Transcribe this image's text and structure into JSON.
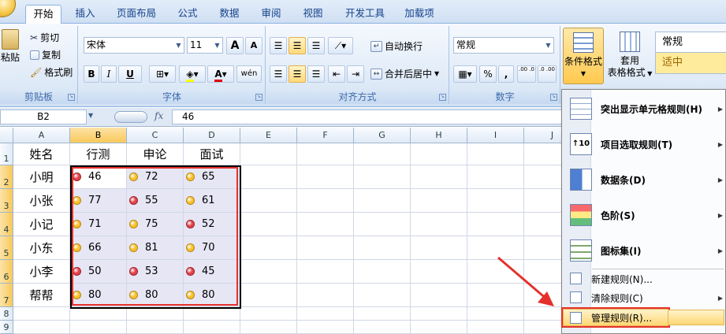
{
  "tabs": [
    "开始",
    "插入",
    "页面布局",
    "公式",
    "数据",
    "审阅",
    "视图",
    "开发工具",
    "加载项"
  ],
  "ribbon": {
    "clipboard": {
      "paste": "粘贴",
      "cut": "剪切",
      "copy": "复制",
      "format_painter": "格式刷",
      "label": "剪贴板"
    },
    "font": {
      "name": "宋体",
      "size": "11",
      "grow": "A",
      "shrink": "A",
      "bold": "B",
      "italic": "I",
      "underline": "U",
      "font_color_letter": "A",
      "phonetic": "wén",
      "label": "字体"
    },
    "alignment": {
      "wrap": "自动换行",
      "merge": "合并后居中",
      "label": "对齐方式"
    },
    "number": {
      "format": "常规",
      "percent": "%",
      "comma": ",",
      "inc_decimal": ".00 .0",
      "dec_decimal": ".0 .00",
      "label": "数字"
    },
    "styles": {
      "conditional": "条件格式",
      "table_line1": "套用",
      "table_line2": "表格格式",
      "normal": "常规",
      "neutral": "适中"
    }
  },
  "formula_bar": {
    "name_box": "B2",
    "fx": "fx",
    "content": "46"
  },
  "columns": [
    "A",
    "B",
    "C",
    "D",
    "E",
    "F",
    "G",
    "H",
    "I",
    "J"
  ],
  "rows": [
    "1",
    "2",
    "3",
    "4",
    "5",
    "6",
    "7",
    "8",
    "9"
  ],
  "headers": [
    "姓名",
    "行测",
    "申论",
    "面试"
  ],
  "records": [
    {
      "name": "小明",
      "v": [
        "46",
        "72",
        "65"
      ],
      "c": [
        "red",
        "yellow",
        "yellow"
      ]
    },
    {
      "name": "小张",
      "v": [
        "77",
        "55",
        "61"
      ],
      "c": [
        "yellow",
        "red",
        "yellow"
      ]
    },
    {
      "name": "小记",
      "v": [
        "71",
        "75",
        "52"
      ],
      "c": [
        "yellow",
        "yellow",
        "red"
      ]
    },
    {
      "name": "小东",
      "v": [
        "66",
        "81",
        "70"
      ],
      "c": [
        "yellow",
        "yellow",
        "yellow"
      ]
    },
    {
      "name": "小李",
      "v": [
        "50",
        "53",
        "45"
      ],
      "c": [
        "red",
        "red",
        "red"
      ]
    },
    {
      "name": "帮帮",
      "v": [
        "80",
        "80",
        "80"
      ],
      "c": [
        "yellow",
        "yellow",
        "yellow"
      ]
    }
  ],
  "dot_colors": {
    "red": "#e2424b",
    "yellow": "#f7c02c"
  },
  "menu": {
    "highlight_rules": "突出显示单元格规则(H)",
    "top_bottom": "项目选取规则(T)",
    "data_bars": "数据条(D)",
    "color_scales": "色阶(S)",
    "icon_sets": "图标集(I)",
    "new_rule": "新建规则(N)...",
    "clear_rules": "清除规则(C)",
    "manage_rules": "管理规则(R)..."
  }
}
